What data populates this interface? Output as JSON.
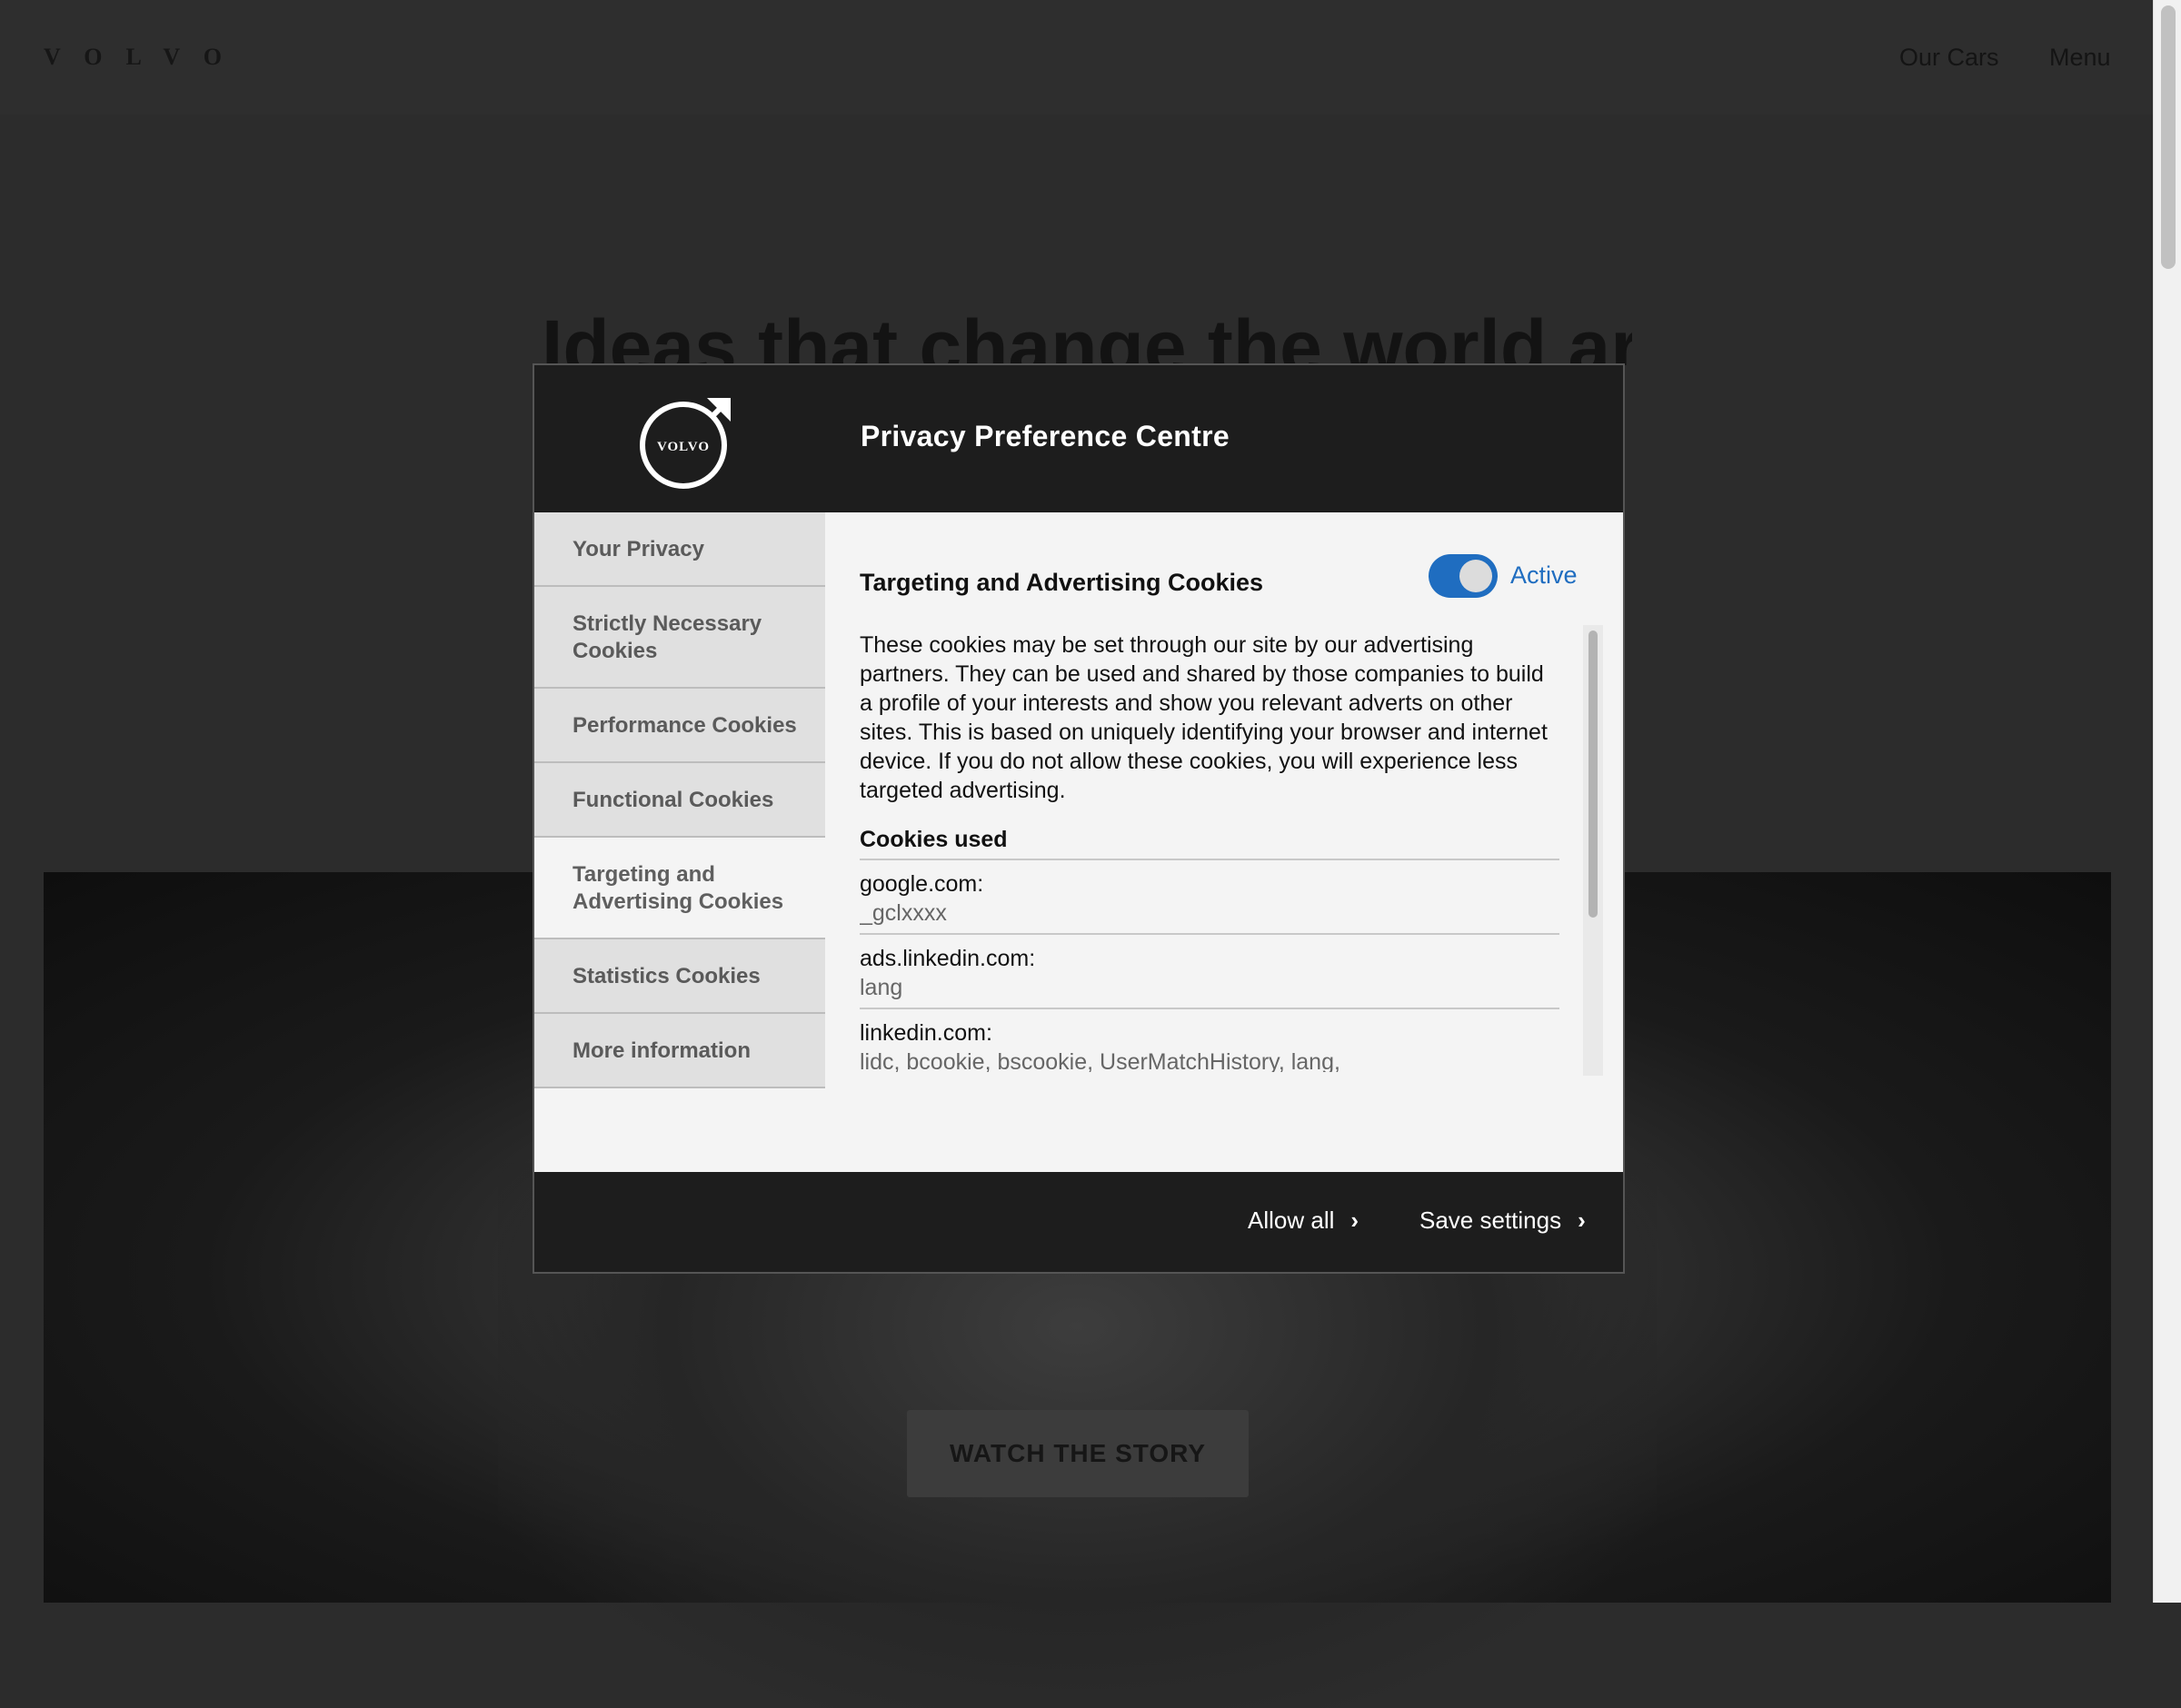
{
  "site": {
    "brand": "VOLVO",
    "nav": {
      "our_cars": "Our Cars",
      "menu": "Menu"
    },
    "hero_headline": "Ideas that change the world are",
    "watch_button": "WATCH THE STORY"
  },
  "modal": {
    "logo_text": "VOLVO",
    "title": "Privacy Preference Centre",
    "tabs": [
      {
        "label": "Your Privacy"
      },
      {
        "label": "Strictly Necessary Cookies"
      },
      {
        "label": "Performance Cookies"
      },
      {
        "label": "Functional Cookies"
      },
      {
        "label": "Targeting and Advertising Cookies",
        "active": true
      },
      {
        "label": "Statistics Cookies"
      },
      {
        "label": "More information"
      }
    ],
    "content": {
      "title": "Targeting and Advertising Cookies",
      "toggle_label": "Active",
      "toggle_on": true,
      "description": "These cookies may be set through our site by our advertising partners. They can be used and shared by those companies to build a profile of your interests and show you relevant adverts on other sites. This is based on uniquely identifying your browser and internet device. If you do not allow these cookies, you will experience less targeted advertising.",
      "cookies_heading": "Cookies used",
      "cookies": [
        {
          "domain": "google.com:",
          "names": "_gclxxxx"
        },
        {
          "domain": "ads.linkedin.com:",
          "names": "lang"
        },
        {
          "domain": "linkedin.com:",
          "names": "lidc, bcookie, bscookie, UserMatchHistory, lang, AnalyticsSyncHistory, li_gc"
        }
      ]
    },
    "footer": {
      "allow_all": "Allow all",
      "save_settings": "Save settings"
    }
  },
  "colors": {
    "accent": "#1f6dc0",
    "header_bg": "#1d1d1d",
    "panel_bg": "#f4f4f4"
  }
}
